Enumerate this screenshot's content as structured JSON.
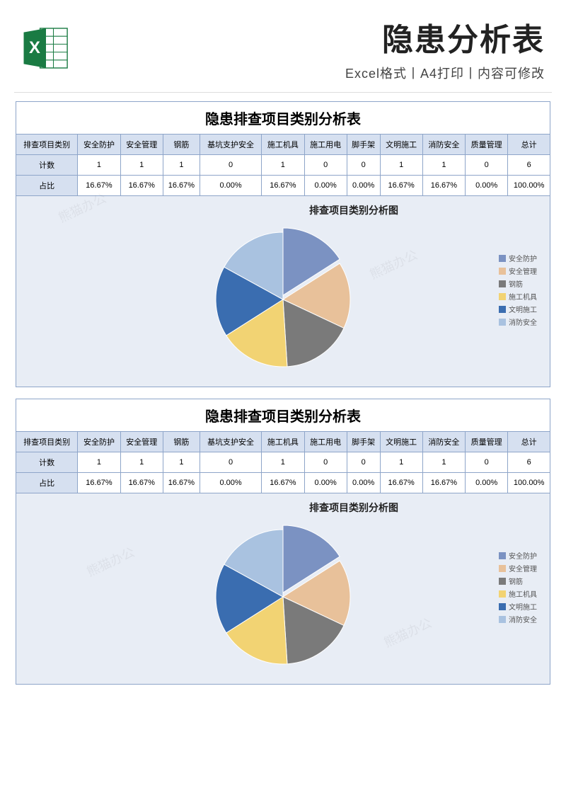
{
  "header": {
    "title": "隐患分析表",
    "subtitle": "Excel格式丨A4打印丨内容可修改"
  },
  "table": {
    "title": "隐患排查项目类别分析表",
    "headers": [
      "排查项目类别",
      "安全防护",
      "安全管理",
      "钢筋",
      "基坑支护安全",
      "施工机具",
      "施工用电",
      "脚手架",
      "文明施工",
      "消防安全",
      "质量管理",
      "总计"
    ],
    "rows": [
      {
        "label": "计数",
        "cells": [
          "1",
          "1",
          "1",
          "0",
          "1",
          "0",
          "0",
          "1",
          "1",
          "0",
          "6"
        ]
      },
      {
        "label": "占比",
        "cells": [
          "16.67%",
          "16.67%",
          "16.67%",
          "0.00%",
          "16.67%",
          "0.00%",
          "0.00%",
          "16.67%",
          "16.67%",
          "0.00%",
          "100.00%"
        ]
      }
    ]
  },
  "chart_data": {
    "type": "pie",
    "title": "排查项目类别分析图",
    "series": [
      {
        "name": "安全防护",
        "value": 16,
        "label": "安全防护\n16%",
        "color": "#7b92c2"
      },
      {
        "name": "安全管理",
        "value": 16,
        "label": "安全管理\n16%",
        "color": "#e8c19a"
      },
      {
        "name": "钢筋",
        "value": 17,
        "label": "钢筋\n17%",
        "color": "#7a7a7a"
      },
      {
        "name": "施工机具",
        "value": 17,
        "label": "施工机具\n17%",
        "color": "#f2d373"
      },
      {
        "name": "文明施工",
        "value": 17,
        "label": "文明施工\n17%",
        "color": "#3a6db0"
      },
      {
        "name": "消防安全",
        "value": 17,
        "label": "消防安全\n17%",
        "color": "#a9c2e0"
      }
    ],
    "legend": [
      "安全防护",
      "安全管理",
      "钢筋",
      "施工机具",
      "文明施工",
      "消防安全"
    ],
    "legend_colors": [
      "#7b92c2",
      "#e8c19a",
      "#7a7a7a",
      "#f2d373",
      "#3a6db0",
      "#a9c2e0"
    ]
  },
  "watermark": "熊猫办公"
}
